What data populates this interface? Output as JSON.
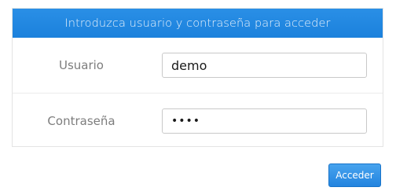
{
  "login": {
    "header": "Introduzca usuario y contraseña para acceder",
    "username_label": "Usuario",
    "username_value": "demo",
    "password_label": "Contraseña",
    "password_value": "demo",
    "submit_label": "Acceder"
  },
  "colors": {
    "header_bg": "#1e88e5",
    "button_bg": "#2f90e4"
  }
}
